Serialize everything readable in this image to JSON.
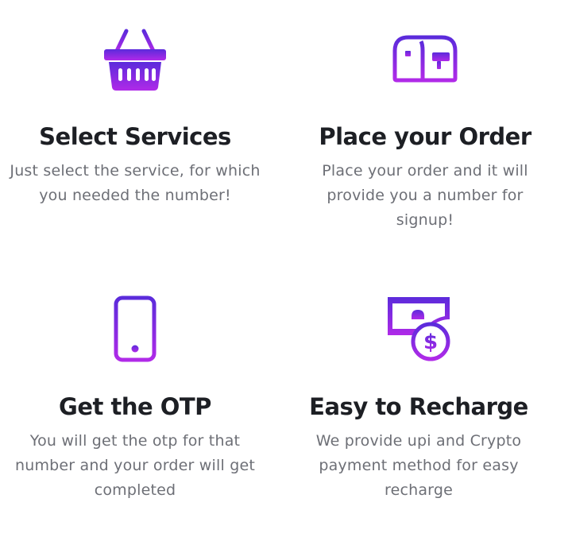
{
  "colors": {
    "gradient_start": "#5b2bdb",
    "gradient_end": "#b02ae8",
    "title": "#1d1f24",
    "text": "#6d6f76"
  },
  "features": [
    {
      "icon": "basket-icon",
      "title": "Select Services",
      "description_lines": [
        "Just select the service, for which",
        "you needed the number!"
      ]
    },
    {
      "icon": "mailbox-icon",
      "title": "Place your Order",
      "description_lines": [
        "Place your order and it will",
        "provide you a number for",
        "signup!"
      ]
    },
    {
      "icon": "smartphone-icon",
      "title": "Get the OTP",
      "description_lines": [
        "You will get the otp for that",
        "number and your order will get",
        "completed"
      ]
    },
    {
      "icon": "money-recharge-icon",
      "title": "Easy to Recharge",
      "description_lines": [
        "We provide upi and Crypto",
        "payment method for easy",
        "recharge"
      ]
    }
  ]
}
